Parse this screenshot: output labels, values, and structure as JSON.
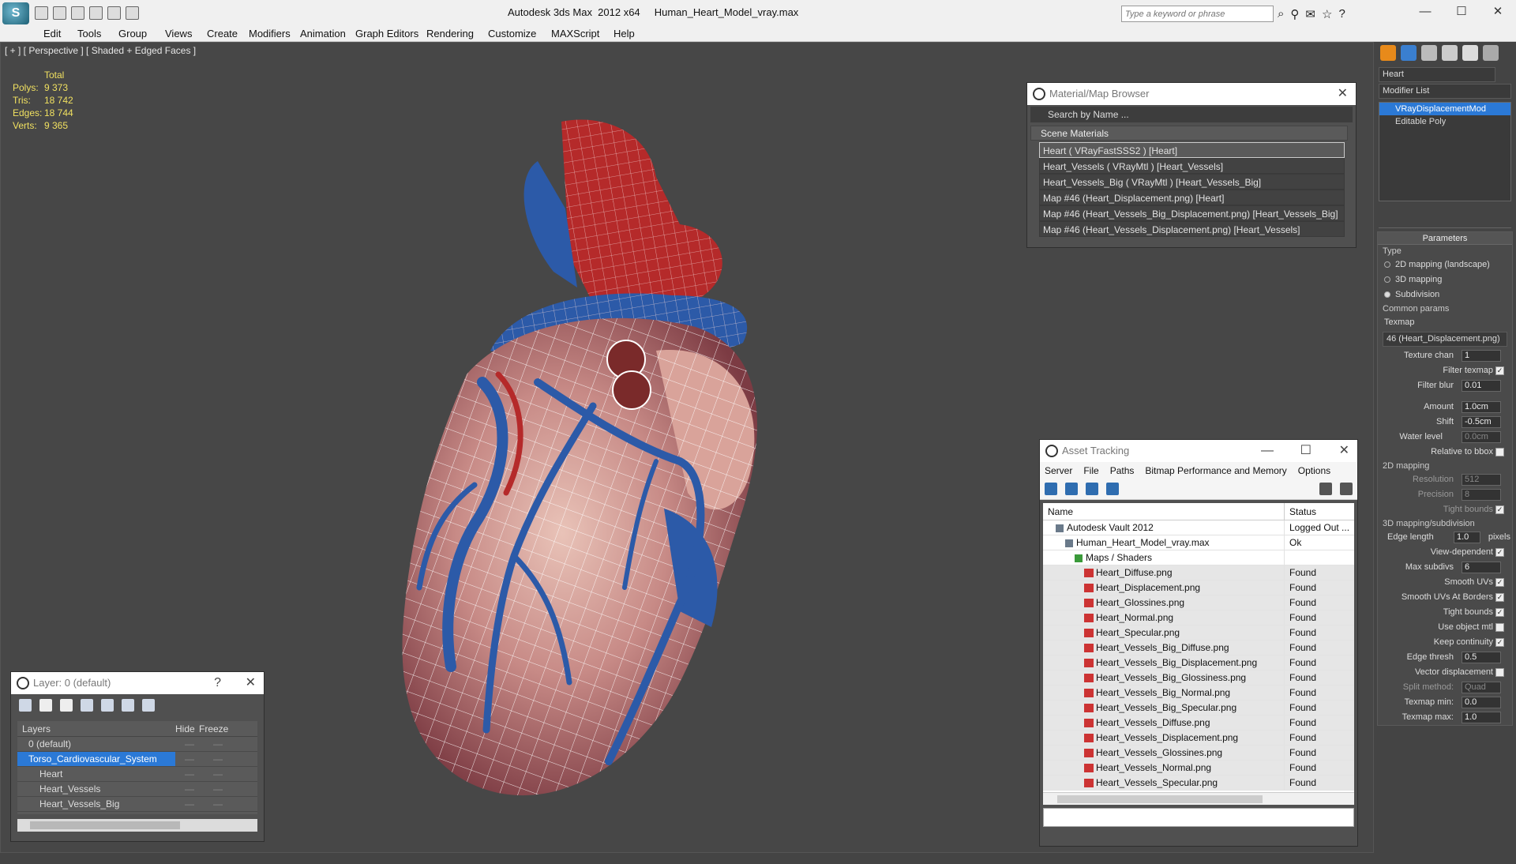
{
  "window": {
    "app_title": "Autodesk 3ds Max  2012 x64",
    "file_title": "Human_Heart_Model_vray.max",
    "search_placeholder": "Type a keyword or phrase"
  },
  "menu": [
    "Edit",
    "Tools",
    "Group",
    "Views",
    "Create",
    "Modifiers",
    "Animation",
    "Graph Editors",
    "Rendering",
    "Customize",
    "MAXScript",
    "Help"
  ],
  "viewport": {
    "label": "[ + ] [ Perspective ] [ Shaded + Edged Faces ]",
    "stats_header": "Total",
    "stats": [
      {
        "label": "Polys:",
        "value": "9 373"
      },
      {
        "label": "Tris:",
        "value": "18 742"
      },
      {
        "label": "Edges:",
        "value": "18 744"
      },
      {
        "label": "Verts:",
        "value": "9 365"
      }
    ]
  },
  "material_browser": {
    "title": "Material/Map Browser",
    "search_placeholder": "Search by Name ...",
    "section": "Scene Materials",
    "items": [
      "Heart  ( VRayFastSSS2 )  [Heart]",
      "Heart_Vessels  ( VRayMtl )  [Heart_Vessels]",
      "Heart_Vessels_Big  ( VRayMtl )  [Heart_Vessels_Big]",
      "Map #46 (Heart_Displacement.png)  [Heart]",
      "Map #46 (Heart_Vessels_Big_Displacement.png)  [Heart_Vessels_Big]",
      "Map #46 (Heart_Vessels_Displacement.png)  [Heart_Vessels]"
    ]
  },
  "asset_tracking": {
    "title": "Asset Tracking",
    "menu": [
      "Server",
      "File",
      "Paths",
      "Bitmap Performance and Memory",
      "Options"
    ],
    "col_name": "Name",
    "col_status": "Status",
    "rows": [
      {
        "name": "Autodesk Vault 2012",
        "status": "Logged Out ...",
        "indent": 1,
        "kind": "vault"
      },
      {
        "name": "Human_Heart_Model_vray.max",
        "status": "Ok",
        "indent": 2,
        "kind": "max"
      },
      {
        "name": "Maps / Shaders",
        "status": "",
        "indent": 3,
        "kind": "folder"
      },
      {
        "name": "Heart_Diffuse.png",
        "status": "Found",
        "indent": 4,
        "kind": "png"
      },
      {
        "name": "Heart_Displacement.png",
        "status": "Found",
        "indent": 4,
        "kind": "png"
      },
      {
        "name": "Heart_Glossines.png",
        "status": "Found",
        "indent": 4,
        "kind": "png"
      },
      {
        "name": "Heart_Normal.png",
        "status": "Found",
        "indent": 4,
        "kind": "png"
      },
      {
        "name": "Heart_Specular.png",
        "status": "Found",
        "indent": 4,
        "kind": "png"
      },
      {
        "name": "Heart_Vessels_Big_Diffuse.png",
        "status": "Found",
        "indent": 4,
        "kind": "png"
      },
      {
        "name": "Heart_Vessels_Big_Displacement.png",
        "status": "Found",
        "indent": 4,
        "kind": "png"
      },
      {
        "name": "Heart_Vessels_Big_Glossiness.png",
        "status": "Found",
        "indent": 4,
        "kind": "png"
      },
      {
        "name": "Heart_Vessels_Big_Normal.png",
        "status": "Found",
        "indent": 4,
        "kind": "png"
      },
      {
        "name": "Heart_Vessels_Big_Specular.png",
        "status": "Found",
        "indent": 4,
        "kind": "png"
      },
      {
        "name": "Heart_Vessels_Diffuse.png",
        "status": "Found",
        "indent": 4,
        "kind": "png"
      },
      {
        "name": "Heart_Vessels_Displacement.png",
        "status": "Found",
        "indent": 4,
        "kind": "png"
      },
      {
        "name": "Heart_Vessels_Glossines.png",
        "status": "Found",
        "indent": 4,
        "kind": "png"
      },
      {
        "name": "Heart_Vessels_Normal.png",
        "status": "Found",
        "indent": 4,
        "kind": "png"
      },
      {
        "name": "Heart_Vessels_Specular.png",
        "status": "Found",
        "indent": 4,
        "kind": "png"
      }
    ]
  },
  "layers": {
    "title": "Layer: 0 (default)",
    "help": "?",
    "col_layers": "Layers",
    "col_hide": "Hide",
    "col_freeze": "Freeze",
    "rows": [
      {
        "name": "0 (default)",
        "indent": 1,
        "selected": false
      },
      {
        "name": "Torso_Cardiovascular_System",
        "indent": 1,
        "selected": true
      },
      {
        "name": "Heart",
        "indent": 2,
        "selected": false
      },
      {
        "name": "Heart_Vessels",
        "indent": 2,
        "selected": false
      },
      {
        "name": "Heart_Vessels_Big",
        "indent": 2,
        "selected": false
      }
    ]
  },
  "command_panel": {
    "object_name": "Heart",
    "modifier_list": "Modifier List",
    "stack": [
      "VRayDisplacementMod",
      "Editable Poly"
    ],
    "rollout_title": "Parameters",
    "type_label": "Type",
    "type_options": [
      {
        "label": "2D mapping (landscape)",
        "on": false
      },
      {
        "label": "3D mapping",
        "on": false
      },
      {
        "label": "Subdivision",
        "on": true
      }
    ],
    "common_params": "Common params",
    "texmap_label": "Texmap",
    "texmap_value": "46 (Heart_Displacement.png)",
    "texture_chan_label": "Texture chan",
    "texture_chan": "1",
    "filter_texmap": "Filter texmap",
    "filter_blur_label": "Filter blur",
    "filter_blur": "0.01",
    "amount_label": "Amount",
    "amount": "1.0cm",
    "shift_label": "Shift",
    "shift": "-0.5cm",
    "water_level_label": "Water level",
    "water_level": "0.0cm",
    "relative_bbox": "Relative to bbox",
    "mapping_2d": "2D mapping",
    "resolution_label": "Resolution",
    "resolution": "512",
    "precision_label": "Precision",
    "precision": "8",
    "tight_bounds": "Tight bounds",
    "subdiv_group": "3D mapping/subdivision",
    "edge_length_label": "Edge length",
    "edge_length": "1.0",
    "pixels": "pixels",
    "view_dependent": "View-dependent",
    "max_subdivs_label": "Max subdivs",
    "max_subdivs": "6",
    "smooth_uvs": "Smooth UVs",
    "smooth_uvs_borders": "Smooth UVs At Borders",
    "tight_bounds2": "Tight bounds",
    "use_object_mtl": "Use object mtl",
    "keep_continuity": "Keep continuity",
    "edge_thresh_label": "Edge thresh",
    "edge_thresh": "0.5",
    "vector_disp": "Vector displacement",
    "split_method_label": "Split method:",
    "split_method": "Quad",
    "texmap_min_label": "Texmap min:",
    "texmap_min": "0.0",
    "texmap_max_label": "Texmap max:",
    "texmap_max": "1.0"
  },
  "colors": {
    "viewport_bg": "#474747",
    "selection": "#2b79d6",
    "stats_text": "#f0e060",
    "heart_red": "#b52a2a",
    "vessel_blue": "#2c5aa8"
  }
}
